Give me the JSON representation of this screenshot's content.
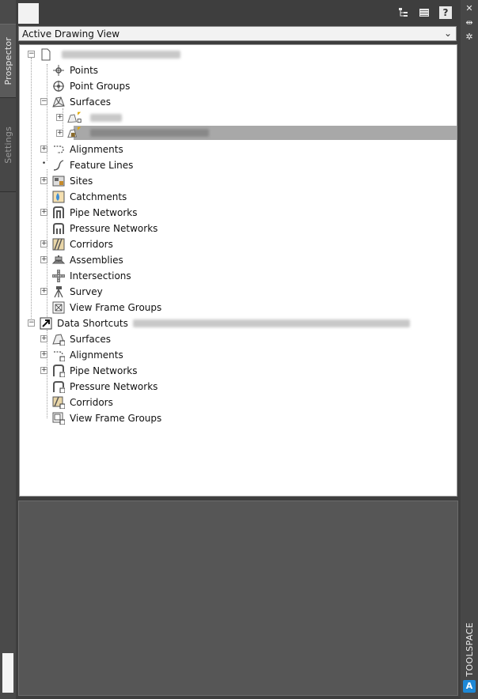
{
  "left_tabs": {
    "prospector": "Prospector",
    "settings": "Settings"
  },
  "toolbar": {
    "icons": [
      "tree-view-icon",
      "item-view-icon",
      "help-icon"
    ]
  },
  "view_selector": {
    "value": "Active Drawing View"
  },
  "tree": {
    "drawing_node": {
      "label": "",
      "obscured": true
    },
    "items": [
      {
        "label": "Points",
        "icon": "points-icon"
      },
      {
        "label": "Point Groups",
        "icon": "point-groups-icon"
      },
      {
        "label": "Surfaces",
        "icon": "surfaces-icon"
      },
      {
        "label": "Alignments",
        "icon": "alignments-icon"
      },
      {
        "label": "Feature Lines",
        "icon": "feature-lines-icon"
      },
      {
        "label": "Sites",
        "icon": "sites-icon"
      },
      {
        "label": "Catchments",
        "icon": "catchments-icon"
      },
      {
        "label": "Pipe Networks",
        "icon": "pipe-networks-icon"
      },
      {
        "label": "Pressure Networks",
        "icon": "pressure-networks-icon"
      },
      {
        "label": "Corridors",
        "icon": "corridors-icon"
      },
      {
        "label": "Assemblies",
        "icon": "assemblies-icon"
      },
      {
        "label": "Intersections",
        "icon": "intersections-icon"
      },
      {
        "label": "Survey",
        "icon": "survey-icon"
      },
      {
        "label": "View Frame Groups",
        "icon": "view-frame-groups-icon"
      }
    ],
    "surface_children": [
      {
        "label": "",
        "obscured": true
      },
      {
        "label": "",
        "obscured": true,
        "highlighted": true
      }
    ],
    "data_shortcuts": {
      "label": "Data Shortcuts",
      "path_obscured": true,
      "items": [
        {
          "label": "Surfaces",
          "icon": "shortcut-surfaces-icon"
        },
        {
          "label": "Alignments",
          "icon": "shortcut-alignments-icon"
        },
        {
          "label": "Pipe Networks",
          "icon": "shortcut-pipe-networks-icon"
        },
        {
          "label": "Pressure Networks",
          "icon": "shortcut-pressure-networks-icon"
        },
        {
          "label": "Corridors",
          "icon": "shortcut-corridors-icon"
        },
        {
          "label": "View Frame Groups",
          "icon": "shortcut-view-frame-groups-icon"
        }
      ]
    }
  },
  "right_strip": {
    "title": "TOOLSPACE",
    "logo": "A"
  }
}
